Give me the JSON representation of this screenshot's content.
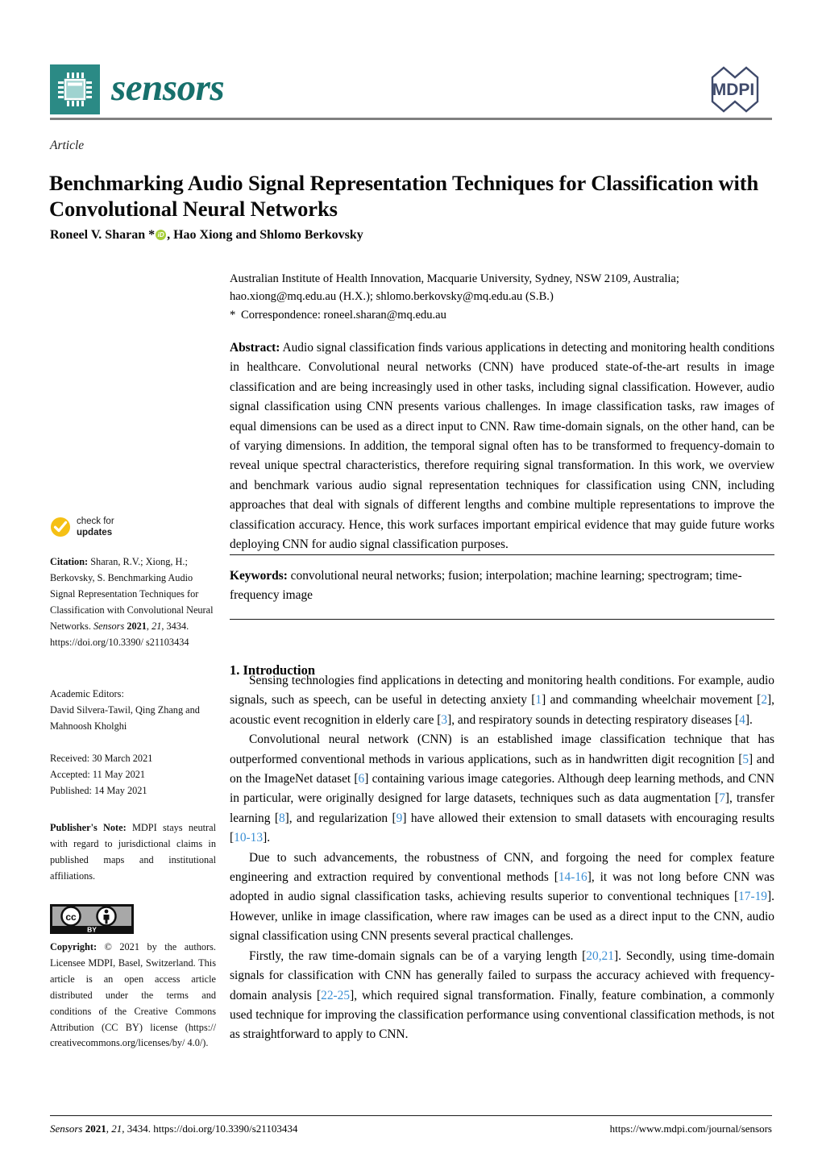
{
  "header": {
    "journal_name": "sensors",
    "publisher_logo_text": "MDPI",
    "chip_icon": "microchip-icon"
  },
  "article": {
    "type": "Article",
    "title": "Benchmarking Audio Signal Representation Techniques for Classification with Convolutional Neural Networks",
    "authors_pre": "Roneel V. Sharan *",
    "authors_post": ", Hao Xiong and Shlomo Berkovsky",
    "affiliation_line1": "Australian Institute of Health Innovation, Macquarie University, Sydney, NSW 2109, Australia;",
    "affiliation_line2": "hao.xiong@mq.edu.au (H.X.); shlomo.berkovsky@mq.edu.au (S.B.)",
    "correspondence_marker": "*",
    "correspondence": "Correspondence: roneel.sharan@mq.edu.au"
  },
  "abstract": {
    "label": "Abstract:",
    "text": " Audio signal classification finds various applications in detecting and monitoring health conditions in healthcare. Convolutional neural networks (CNN) have produced state-of-the-art results in image classification and are being increasingly used in other tasks, including signal classification. However, audio signal classification using CNN presents various challenges. In image classification tasks, raw images of equal dimensions can be used as a direct input to CNN. Raw time-domain signals, on the other hand, can be of varying dimensions. In addition, the temporal signal often has to be transformed to frequency-domain to reveal unique spectral characteristics, therefore requiring signal transformation. In this work, we overview and benchmark various audio signal representation techniques for classification using CNN, including approaches that deal with signals of different lengths and combine multiple representations to improve the classification accuracy. Hence, this work surfaces important empirical evidence that may guide future works deploying CNN for audio signal classification purposes."
  },
  "keywords": {
    "label": "Keywords:",
    "text": " convolutional neural networks; fusion; interpolation; machine learning; spectrogram; time-frequency image"
  },
  "introduction": {
    "heading": "1. Introduction",
    "paragraphs": [
      "Sensing technologies find applications in detecting and monitoring health conditions. For example, audio signals, such as speech, can be useful in detecting anxiety [1] and commanding wheelchair movement [2], acoustic event recognition in elderly care [3], and respiratory sounds in detecting respiratory diseases [4].",
      "Convolutional neural network (CNN) is an established image classification technique that has outperformed conventional methods in various applications, such as in handwritten digit recognition [5] and on the ImageNet dataset [6] containing various image categories. Although deep learning methods, and CNN in particular, were originally designed for large datasets, techniques such as data augmentation [7], transfer learning [8], and regularization [9] have allowed their extension to small datasets with encouraging results [10-13].",
      "Due to such advancements, the robustness of CNN, and forgoing the need for complex feature engineering and extraction required by conventional methods [14-16], it was not long before CNN was adopted in audio signal classification tasks, achieving results superior to conventional techniques [17-19]. However, unlike in image classification, where raw images can be used as a direct input to the CNN, audio signal classification using CNN presents several practical challenges.",
      "Firstly, the raw time-domain signals can be of a varying length [20,21]. Secondly, using time-domain signals for classification with CNN has generally failed to surpass the accuracy achieved with frequency-domain analysis [22-25], which required signal transformation. Finally, feature combination, a commonly used technique for improving the classification performance using conventional classification methods, is not as straightforward to apply to CNN."
    ],
    "citation_refs": [
      "1",
      "2",
      "3",
      "4",
      "5",
      "6",
      "7",
      "8",
      "9",
      "10–13",
      "14–16",
      "17–19",
      "20,21",
      "22–25"
    ]
  },
  "sidebar": {
    "check_for_updates": {
      "line1": "check for",
      "line2": "updates",
      "icon": "check-circle-icon"
    },
    "citation": {
      "label": "Citation:",
      "text_part1": "  Sharan, R.V.; Xiong, H.; Berkovsky, S. Benchmarking Audio Signal Representation Techniques for Classification with Convolutional Neural Networks. ",
      "journal": "Sensors",
      "year": "2021",
      "volume": "21",
      "pages_doi": ", 3434.  https://doi.org/10.3390/ s21103434"
    },
    "academic_editors": {
      "label": "Academic Editors:",
      "names": "David Silvera-Tawil, Qing Zhang and Mahnoosh Kholghi"
    },
    "dates": {
      "received": "Received: 30 March 2021",
      "accepted": "Accepted: 11 May 2021",
      "published": "Published: 14 May 2021"
    },
    "publisher_note": {
      "label": "Publisher's Note:",
      "text": " MDPI stays neutral with regard to jurisdictional claims in published maps and institutional affiliations."
    },
    "cc_badge": {
      "cc_icon": "creative-commons-icon",
      "by_icon": "attribution-person-icon",
      "by_label": "BY"
    },
    "copyright": {
      "label": "Copyright:",
      "text": " © 2021 by the authors. Licensee MDPI, Basel, Switzerland. This article is an open access article distributed under the terms and conditions of the Creative Commons Attribution (CC BY) license (https:// creativecommons.org/licenses/by/ 4.0/)."
    }
  },
  "footer": {
    "journal": "Sensors",
    "year": "2021",
    "volume": "21",
    "citation_rest": ", 3434. https://doi.org/10.3390/s21103434",
    "url": "https://www.mdpi.com/journal/sensors"
  },
  "colors": {
    "journal_teal": "#2b8a85",
    "journal_text_teal": "#17706c",
    "mdpi_navy": "#3f4a6b",
    "reference_link": "#3b8fd4",
    "orcid_green": "#a6ce39",
    "check_updates_yellow": "#f5c015",
    "rule_gray": "#808080"
  }
}
